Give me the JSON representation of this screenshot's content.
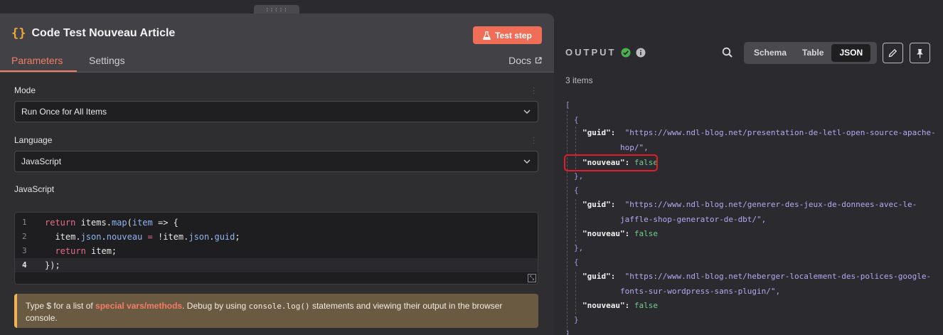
{
  "drag_handle": ":::::",
  "node": {
    "title": "Code Test Nouveau Article",
    "test_step_label": "Test step"
  },
  "tabs": {
    "parameters": "Parameters",
    "settings": "Settings",
    "docs": "Docs"
  },
  "fields": {
    "mode_label": "Mode",
    "mode_value": "Run Once for All Items",
    "language_label": "Language",
    "language_value": "JavaScript",
    "code_label": "JavaScript"
  },
  "code_lines": {
    "n1": "1",
    "n2": "2",
    "n3": "3",
    "n4": "4",
    "l1_kw": "return",
    "l1_a": " items.",
    "l1_fn": "map",
    "l1_b": "(",
    "l1_param": "item",
    "l1_c": " => {",
    "l2_a": "  item.",
    "l2_p1": "json",
    "l2_b": ".",
    "l2_p2": "nouveau",
    "l2_op": " = ",
    "l2_c": "!item.",
    "l2_p3": "json",
    "l2_d": ".",
    "l2_p4": "guid",
    "l2_e": ";",
    "l3_kw": "  return",
    "l3_a": " item;",
    "l4": "});"
  },
  "hint": {
    "prefix": "Type $ for a list of ",
    "link": "special vars/methods",
    "middle": ". Debug by using ",
    "code": "console.log()",
    "suffix": " statements and viewing their output in the browser console."
  },
  "output": {
    "title": "OUTPUT",
    "status_color": "#4caf50",
    "views": [
      "Schema",
      "Table",
      "JSON"
    ],
    "active_view": "JSON",
    "items_count": "3 items"
  },
  "json_output": {
    "open_bracket": "[",
    "open_brace": "{",
    "close_brace": "},",
    "close_brace_last": "}",
    "close_bracket": "]",
    "guid_key": "\"guid\":",
    "nouveau_key": "\"nouveau\":",
    "false_value": "false",
    "item1_guid_a": "\"https://www.ndl-blog.net/presentation-de-letl-open-source-apache-",
    "item1_guid_b": "hop/\",",
    "item2_guid_a": "\"https://www.ndl-blog.net/generer-des-jeux-de-donnees-avec-le-",
    "item2_guid_b": "jaffle-shop-generator-de-dbt/\",",
    "item3_guid_a": "\"https://www.ndl-blog.net/heberger-localement-des-polices-google-",
    "item3_guid_b": "fonts-sur-wordpress-sans-plugin/\","
  },
  "colors": {
    "accent": "#f27d66",
    "test_button": "#f06e58",
    "highlight": "#e01e2a"
  }
}
